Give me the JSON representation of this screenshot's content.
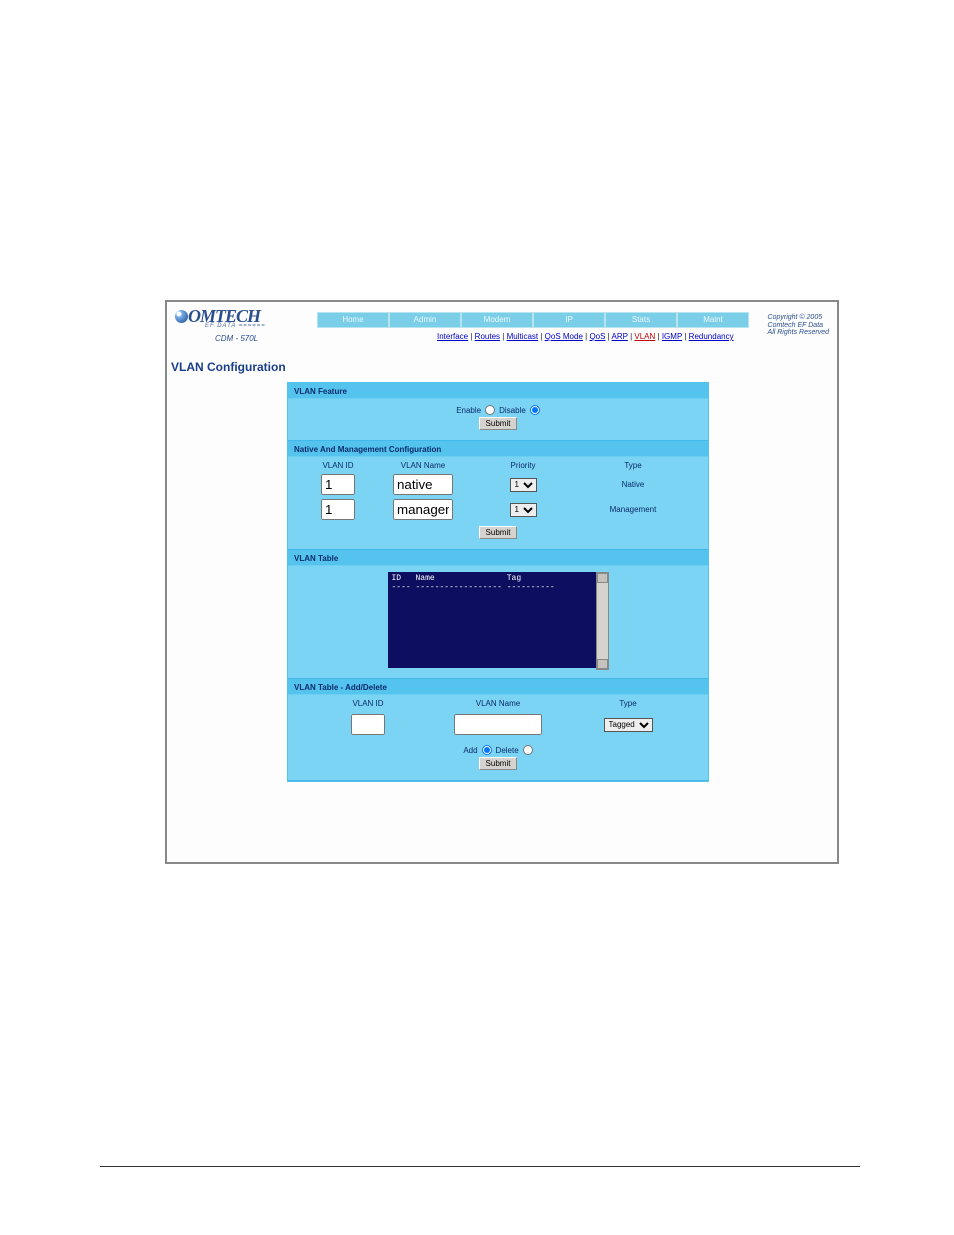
{
  "logo": {
    "text": "OMTECH",
    "sub1": "EF DATA ======",
    "sub2": "CDM - 570L"
  },
  "copyright": {
    "l1": "Copyright © 2005",
    "l2": "Comtech EF Data",
    "l3": "All Rights Reserved"
  },
  "nav": {
    "items": [
      "Home",
      "Admin",
      "Modem",
      "IP",
      "Stats",
      "Maint"
    ]
  },
  "subnav": {
    "items": [
      "Interface",
      "Routes",
      "Multicast",
      "QoS Mode",
      "QoS",
      "ARP",
      "VLAN",
      "IGMP",
      "Redundancy"
    ],
    "active_index": 6
  },
  "page_title": "VLAN Configuration",
  "feature": {
    "title": "VLAN Feature",
    "enable_label": "Enable",
    "disable_label": "Disable",
    "submit": "Submit"
  },
  "native": {
    "title": "Native And Management Configuration",
    "hdr_id": "VLAN ID",
    "hdr_name": "VLAN Name",
    "hdr_priority": "Priority",
    "hdr_type": "Type",
    "rows": [
      {
        "id": "1",
        "name": "native",
        "priority": "1",
        "type": "Native"
      },
      {
        "id": "1",
        "name": "management",
        "priority": "1",
        "type": "Management"
      }
    ],
    "submit": "Submit"
  },
  "table": {
    "title": "VLAN Table",
    "header": "ID   Name               Tag\n---- ------------------ ----------"
  },
  "adddel": {
    "title": "VLAN Table - Add/Delete",
    "hdr_id": "VLAN ID",
    "hdr_name": "VLAN Name",
    "hdr_type": "Type",
    "type_value": "Tagged",
    "add_label": "Add",
    "delete_label": "Delete",
    "submit": "Submit"
  }
}
